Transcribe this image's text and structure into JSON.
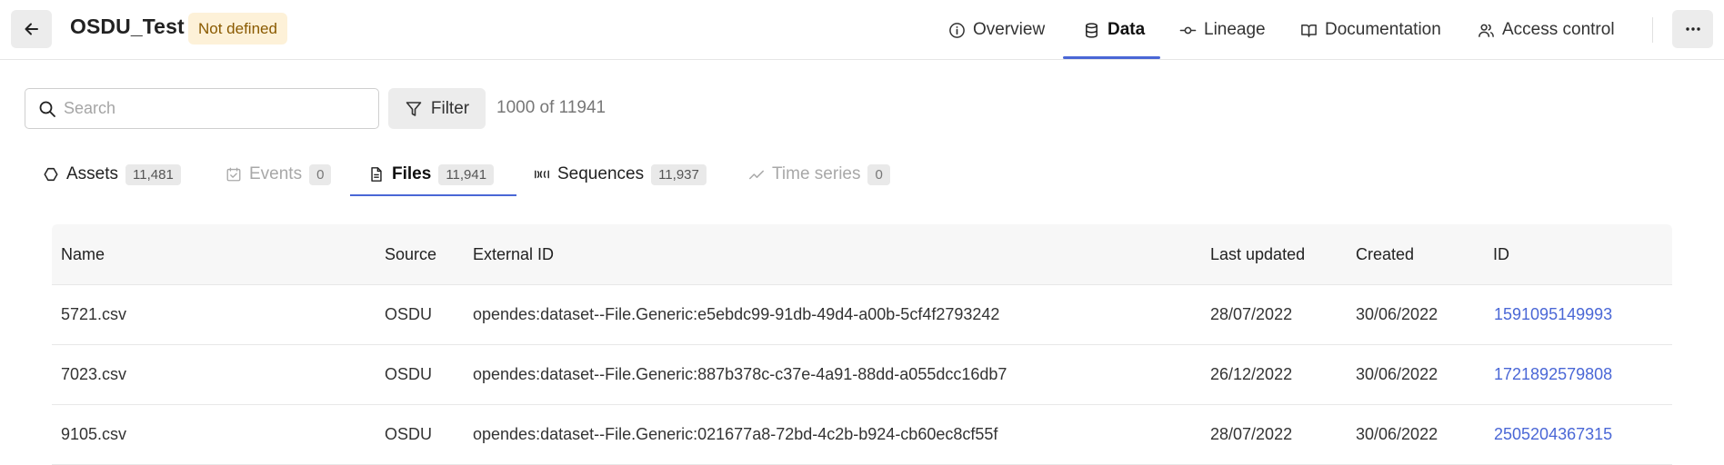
{
  "header": {
    "title": "OSDU_Test",
    "status_badge": "Not defined",
    "nav": [
      {
        "label": "Overview",
        "icon": "info-icon"
      },
      {
        "label": "Data",
        "icon": "database-icon",
        "active": true
      },
      {
        "label": "Lineage",
        "icon": "lineage-icon"
      },
      {
        "label": "Documentation",
        "icon": "book-icon"
      },
      {
        "label": "Access control",
        "icon": "users-icon"
      }
    ],
    "accent_color": "#4a67d6"
  },
  "toolbar": {
    "search_placeholder": "Search",
    "filter_label": "Filter",
    "result_count": "1000 of 11941"
  },
  "subtabs": [
    {
      "label": "Assets",
      "count": "11,481",
      "icon": "asset-icon"
    },
    {
      "label": "Events",
      "count": "0",
      "icon": "event-icon",
      "disabled": true
    },
    {
      "label": "Files",
      "count": "11,941",
      "icon": "file-icon",
      "active": true
    },
    {
      "label": "Sequences",
      "count": "11,937",
      "icon": "sequence-icon"
    },
    {
      "label": "Time series",
      "count": "0",
      "icon": "timeseries-icon",
      "disabled": true
    }
  ],
  "table": {
    "columns": [
      "Name",
      "Source",
      "External ID",
      "Last updated",
      "Created",
      "ID"
    ],
    "rows": [
      {
        "name": "5721.csv",
        "source": "OSDU",
        "external_id": "opendes:dataset--File.Generic:e5ebdc99-91db-49d4-a00b-5cf4f2793242",
        "last_updated": "28/07/2022",
        "created": "30/06/2022",
        "id": "1591095149993"
      },
      {
        "name": "7023.csv",
        "source": "OSDU",
        "external_id": "opendes:dataset--File.Generic:887b378c-c37e-4a91-88dd-a055dcc16db7",
        "last_updated": "26/12/2022",
        "created": "30/06/2022",
        "id": "1721892579808"
      },
      {
        "name": "9105.csv",
        "source": "OSDU",
        "external_id": "opendes:dataset--File.Generic:021677a8-72bd-4c2b-b924-cb60ec8cf55f",
        "last_updated": "28/07/2022",
        "created": "30/06/2022",
        "id": "2505204367315"
      }
    ]
  }
}
